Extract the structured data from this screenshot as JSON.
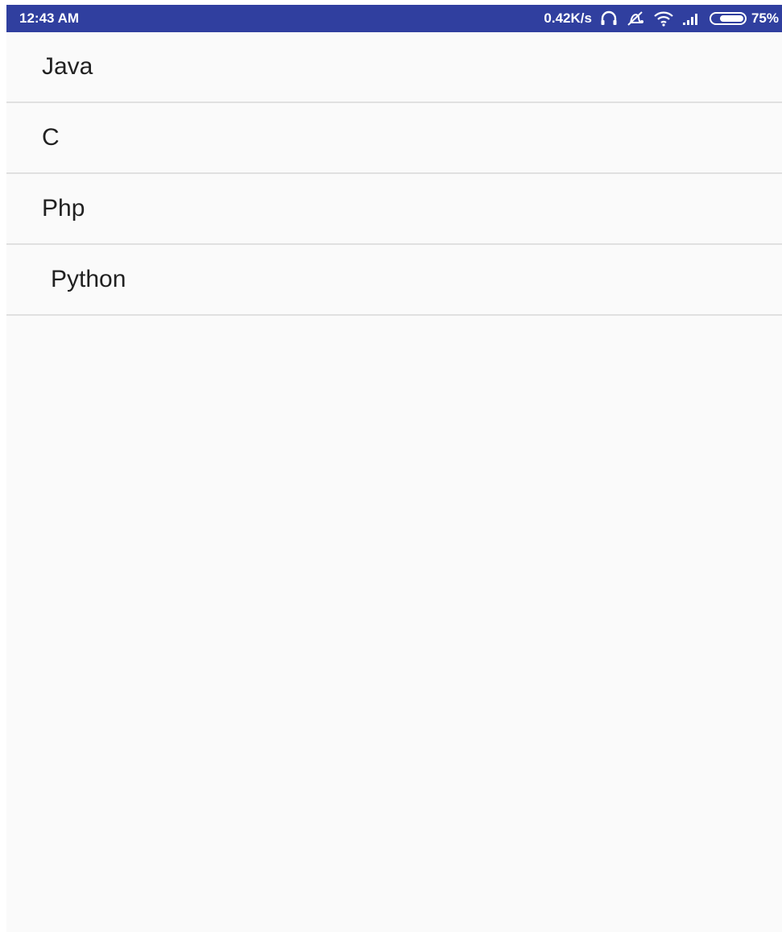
{
  "status_bar": {
    "time": "12:43 AM",
    "net_speed": "0.42K/s",
    "battery_percent": "75%",
    "battery_level": 0.75,
    "icons": [
      "headset-icon",
      "alarm-off-icon",
      "wifi-icon",
      "signal-icon",
      "battery-icon"
    ],
    "color": "#303f9f"
  },
  "list": {
    "items": [
      {
        "label": "Java"
      },
      {
        "label": "C"
      },
      {
        "label": "Php"
      },
      {
        "label": "Python"
      }
    ]
  }
}
